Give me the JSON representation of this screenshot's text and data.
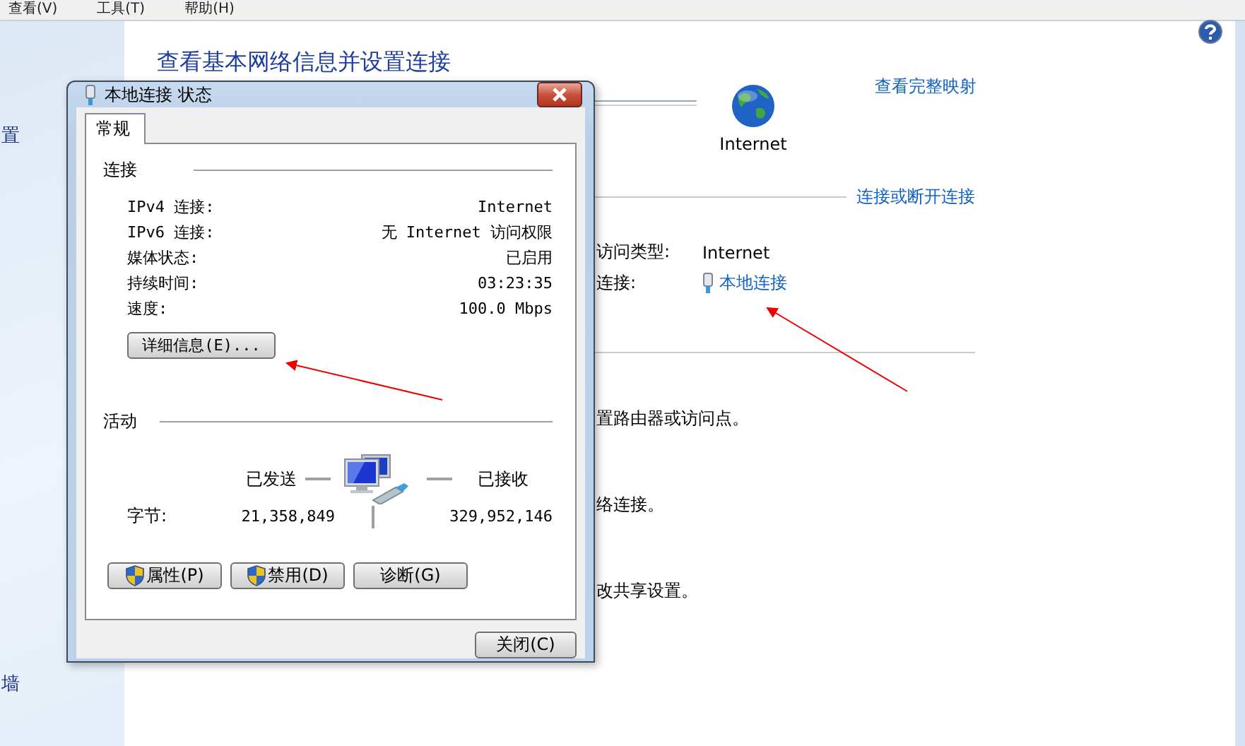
{
  "menu_bar": [
    {
      "label": "查看(V)"
    },
    {
      "label": "工具(T)"
    },
    {
      "label": "帮助(H)"
    }
  ],
  "sidebar": {
    "items": [
      "置",
      "墙"
    ]
  },
  "main": {
    "title": "查看基本网络信息并设置连接",
    "network_map": {
      "node_label": "Internet",
      "link": "查看完整映射"
    },
    "connections": {
      "link": "连接或断开连接",
      "rows": [
        {
          "label": "访问类型:",
          "value": "Internet",
          "kind": "text"
        },
        {
          "label": "连接:",
          "value": "本地连接",
          "kind": "link"
        }
      ]
    },
    "tasks": [
      "置路由器或访问点。",
      "络连接。",
      "改共享设置。"
    ]
  },
  "dialog": {
    "title": "本地连接 状态",
    "tabs": [
      {
        "label": "常规",
        "selected": true
      }
    ],
    "connection": {
      "heading": "连接",
      "rows": [
        {
          "label": "IPv4 连接:",
          "value": "Internet"
        },
        {
          "label": "IPv6 连接:",
          "value": "无 Internet 访问权限"
        },
        {
          "label": "媒体状态:",
          "value": "已启用"
        },
        {
          "label": "持续时间:",
          "value": "03:23:35"
        },
        {
          "label": "速度:",
          "value": "100.0 Mbps"
        }
      ]
    },
    "details_button": "详细信息(E)...",
    "activity": {
      "heading": "活动",
      "sent_label": "已发送",
      "received_label": "已接收",
      "bytes_label": "字节:",
      "bytes_sent": "21,358,849",
      "bytes_received": "329,952,146"
    },
    "buttons": [
      {
        "label": "属性(P)",
        "kind": "shield"
      },
      {
        "label": "禁用(D)",
        "kind": "shield"
      },
      {
        "label": "诊断(G)",
        "kind": "plain"
      }
    ],
    "close_button": "关闭(C)"
  }
}
